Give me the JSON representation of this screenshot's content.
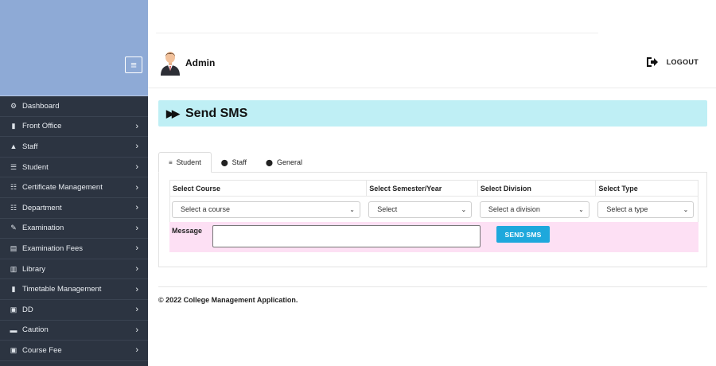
{
  "sidebar": {
    "items": [
      {
        "label": "Dashboard",
        "icon": "dashboard-icon",
        "glyph": "⚙",
        "arrow": ""
      },
      {
        "label": "Front Office",
        "icon": "front-office-icon",
        "glyph": "▮",
        "arrow": "›"
      },
      {
        "label": "Staff",
        "icon": "user-icon",
        "glyph": "▲",
        "arrow": "›"
      },
      {
        "label": "Student",
        "icon": "users-icon",
        "glyph": "☰",
        "arrow": "›"
      },
      {
        "label": "Certificate Management",
        "icon": "sitemap-icon",
        "glyph": "☷",
        "arrow": "›"
      },
      {
        "label": "Department",
        "icon": "sitemap-icon",
        "glyph": "☷",
        "arrow": "›"
      },
      {
        "label": "Examination",
        "icon": "edit-icon",
        "glyph": "✎",
        "arrow": "›"
      },
      {
        "label": "Examination Fees",
        "icon": "list-icon",
        "glyph": "▤",
        "arrow": "›"
      },
      {
        "label": "Library",
        "icon": "book-icon",
        "glyph": "▥",
        "arrow": "›"
      },
      {
        "label": "Timetable Management",
        "icon": "file-icon",
        "glyph": "▮",
        "arrow": "›"
      },
      {
        "label": "DD",
        "icon": "money-icon",
        "glyph": "▣",
        "arrow": "›"
      },
      {
        "label": "Caution",
        "icon": "card-icon",
        "glyph": "▬",
        "arrow": "›"
      },
      {
        "label": "Course Fee",
        "icon": "money-icon",
        "glyph": "▣",
        "arrow": "›"
      }
    ],
    "toggle_glyph": "≡"
  },
  "header": {
    "user": "Admin",
    "logout": "LOGOUT"
  },
  "page": {
    "title_glyph": "▶▶",
    "title": "Send SMS"
  },
  "tabs": [
    {
      "label": "Student",
      "glyph": "≡"
    },
    {
      "label": "Staff",
      "glyph": "⬤"
    },
    {
      "label": "General",
      "glyph": "⬤"
    }
  ],
  "form": {
    "headers": [
      "Select Course",
      "Select Semester/Year",
      "Select Division",
      "Select Type"
    ],
    "selects": [
      "Select a course",
      "Select",
      "Select a division",
      "Select a type"
    ],
    "chevron": "⌄",
    "message_label": "Message",
    "message_value": "",
    "send_label": "SEND SMS"
  },
  "footer": {
    "text": "© 2022 College Management Application."
  },
  "colors": {
    "sidebar_bg": "#2c3441",
    "sidebar_top": "#8eaad6",
    "title_bar": "#bfeff5",
    "message_row": "#fde0f4",
    "send_button": "#1ea8dc"
  }
}
